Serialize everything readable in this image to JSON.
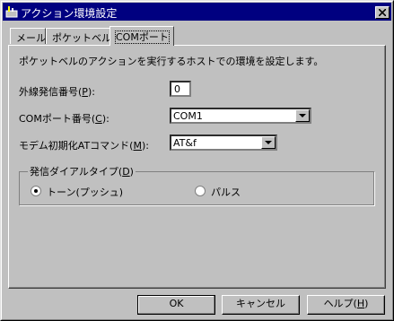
{
  "window": {
    "title": "アクション環境設定"
  },
  "tabs": [
    {
      "label": "メール"
    },
    {
      "label": "ポケットベル"
    },
    {
      "label": "COMポート"
    }
  ],
  "panel": {
    "description": "ポケットベルのアクションを実行するホストでの環境を設定します。",
    "outside_line": {
      "label_pre": "外線発信番号(",
      "accel": "P",
      "label_post": "):",
      "value": "0"
    },
    "com_port": {
      "label_pre": "COMポート番号(",
      "accel": "C",
      "label_post": "):",
      "value": "COM1"
    },
    "modem_init": {
      "label_pre": "モデム初期化ATコマンド(",
      "accel": "M",
      "label_post": "):",
      "value": "AT&f"
    },
    "dial_type": {
      "title_pre": "発信ダイアルタイプ(",
      "title_accel": "D",
      "title_post": ")",
      "options": [
        {
          "label": "トーン(プッシュ)",
          "selected": true
        },
        {
          "label": "パルス",
          "selected": false
        }
      ]
    }
  },
  "buttons": {
    "ok": "OK",
    "cancel": "キャンセル",
    "help_pre": "ヘルプ(",
    "help_accel": "H",
    "help_post": ")"
  }
}
